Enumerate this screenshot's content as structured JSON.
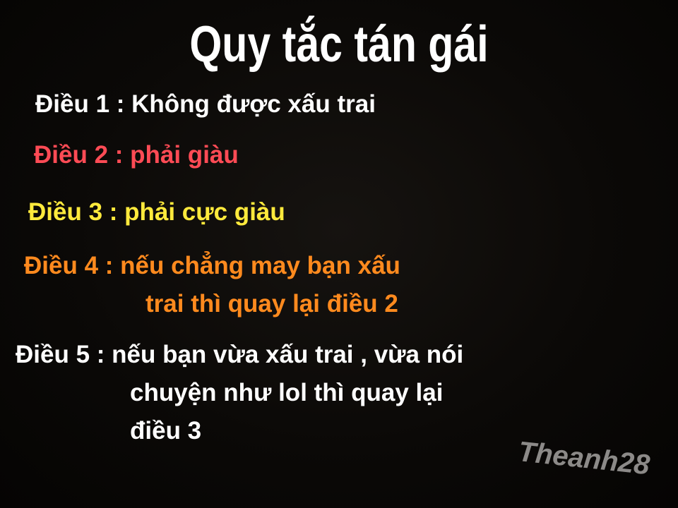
{
  "title": "Quy tắc tán gái",
  "rules": [
    {
      "lines": [
        "Điều 1 :  Không được xấu trai"
      ],
      "color": "#ffffff"
    },
    {
      "lines": [
        "Điều 2 : phải giàu"
      ],
      "color": "#ff4b55"
    },
    {
      "lines": [
        "Điều 3 : phải cực giàu"
      ],
      "color": "#ffea3c"
    },
    {
      "lines": [
        "Điều 4 : nếu chẳng may bạn xấu",
        "trai thì quay lại điều 2"
      ],
      "color": "#ff8a1e"
    },
    {
      "lines": [
        "Điều 5 : nếu bạn vừa xấu trai , vừa nói",
        "chuyện như lol thì quay lại",
        "điều 3"
      ],
      "color": "#ffffff"
    }
  ],
  "watermark": "Theanh28"
}
